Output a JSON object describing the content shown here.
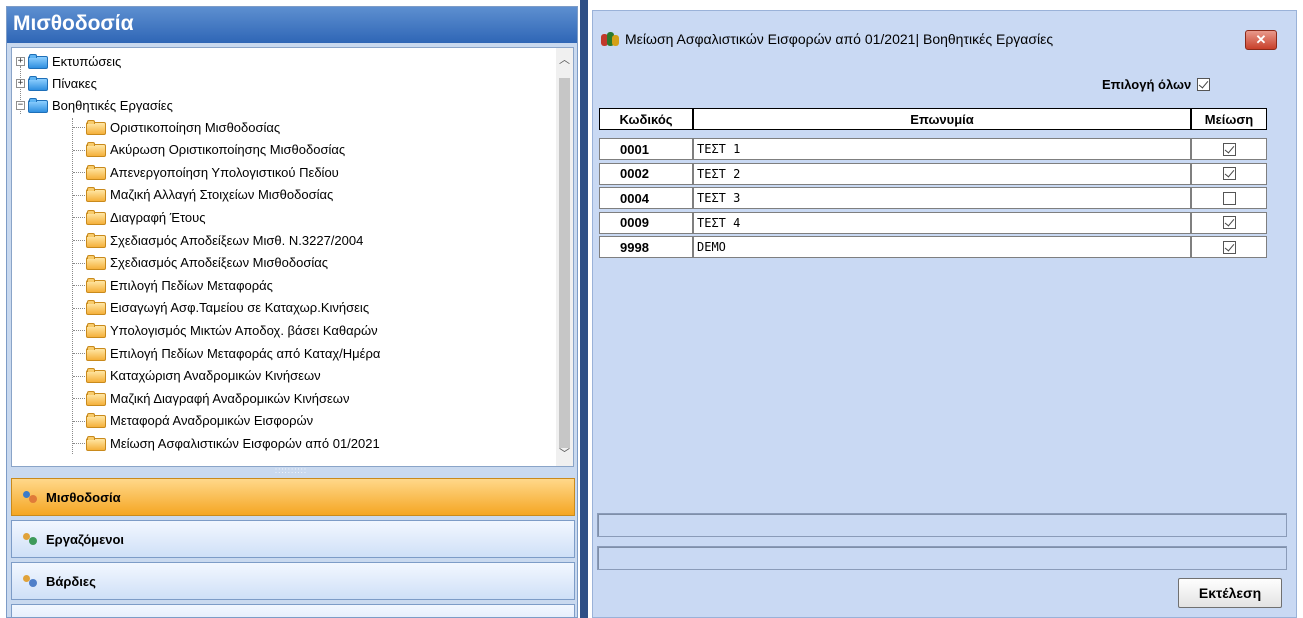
{
  "left_panel": {
    "title": "Μισθοδοσία",
    "tree": {
      "top_nodes": [
        {
          "label": "Εκτυπώσεις",
          "expander": "+"
        },
        {
          "label": "Πίνακες",
          "expander": "+"
        },
        {
          "label": "Βοηθητικές Εργασίες",
          "expander": "−"
        }
      ],
      "children": [
        "Οριστικοποίηση Μισθοδοσίας",
        "Ακύρωση Οριστικοποίησης Μισθοδοσίας",
        "Απενεργοποίηση Υπολογιστικού Πεδίου",
        "Μαζική Αλλαγή Στοιχείων Μισθοδοσίας",
        "Διαγραφή Έτους",
        "Σχεδιασμός Αποδείξεων Μισθ. Ν.3227/2004",
        "Σχεδιασμός Αποδείξεων Μισθοδοσίας",
        "Επιλογή Πεδίων Μεταφοράς",
        "Εισαγωγή Ασφ.Ταμείου σε Καταχωρ.Κινήσεις",
        "Υπολογισμός Μικτών Αποδοχ. βάσει Καθαρών",
        "Επιλογή Πεδίων Μεταφοράς από Καταχ/Ημέρα",
        "Καταχώριση Αναδρομικών Κινήσεων",
        "Μαζική Διαγραφή Αναδρομικών Κινήσεων",
        "Μεταφορά Αναδρομικών Εισφορών",
        "Μείωση Ασφαλιστικών Εισφορών από 01/2021"
      ]
    },
    "splitter_grip": "::::::::::",
    "nav_buttons": [
      {
        "label": "Μισθοδοσία",
        "active": true
      },
      {
        "label": "Εργαζόμενοι",
        "active": false
      },
      {
        "label": "Βάρδιες",
        "active": false
      }
    ]
  },
  "window": {
    "title": "Μείωση Ασφαλιστικών Εισφορών από 01/2021| Βοηθητικές Εργασίες",
    "close_label": "✕",
    "select_all_label": "Επιλογή όλων",
    "select_all_checked": true,
    "grid": {
      "headers": [
        "Κωδικός",
        "Επωνυμία",
        "Μείωση"
      ],
      "rows": [
        {
          "code": "0001",
          "name": "ΤΕΣΤ 1",
          "reduction": true
        },
        {
          "code": "0002",
          "name": "ΤΕΣΤ 2",
          "reduction": true
        },
        {
          "code": "0004",
          "name": "ΤΕΣΤ 3",
          "reduction": false
        },
        {
          "code": "0009",
          "name": "ΤΕΣΤ 4",
          "reduction": true
        },
        {
          "code": "9998",
          "name": "DEMO",
          "reduction": true
        }
      ]
    },
    "run_button_label": "Εκτέλεση"
  },
  "colors": {
    "header_blue": "#2f66b6",
    "panel_bg": "#c9d9ef",
    "active_nav": "#f5a623",
    "divider": "#2e4f86",
    "close_red": "#c8402a"
  },
  "icons": {
    "tree_folder_top": "folder-blue-icon",
    "tree_folder_child": "folder-orange-icon",
    "nav_icon": "users-icon",
    "window_icon": "people-group-icon",
    "checkbox": "checkbox-icon"
  }
}
